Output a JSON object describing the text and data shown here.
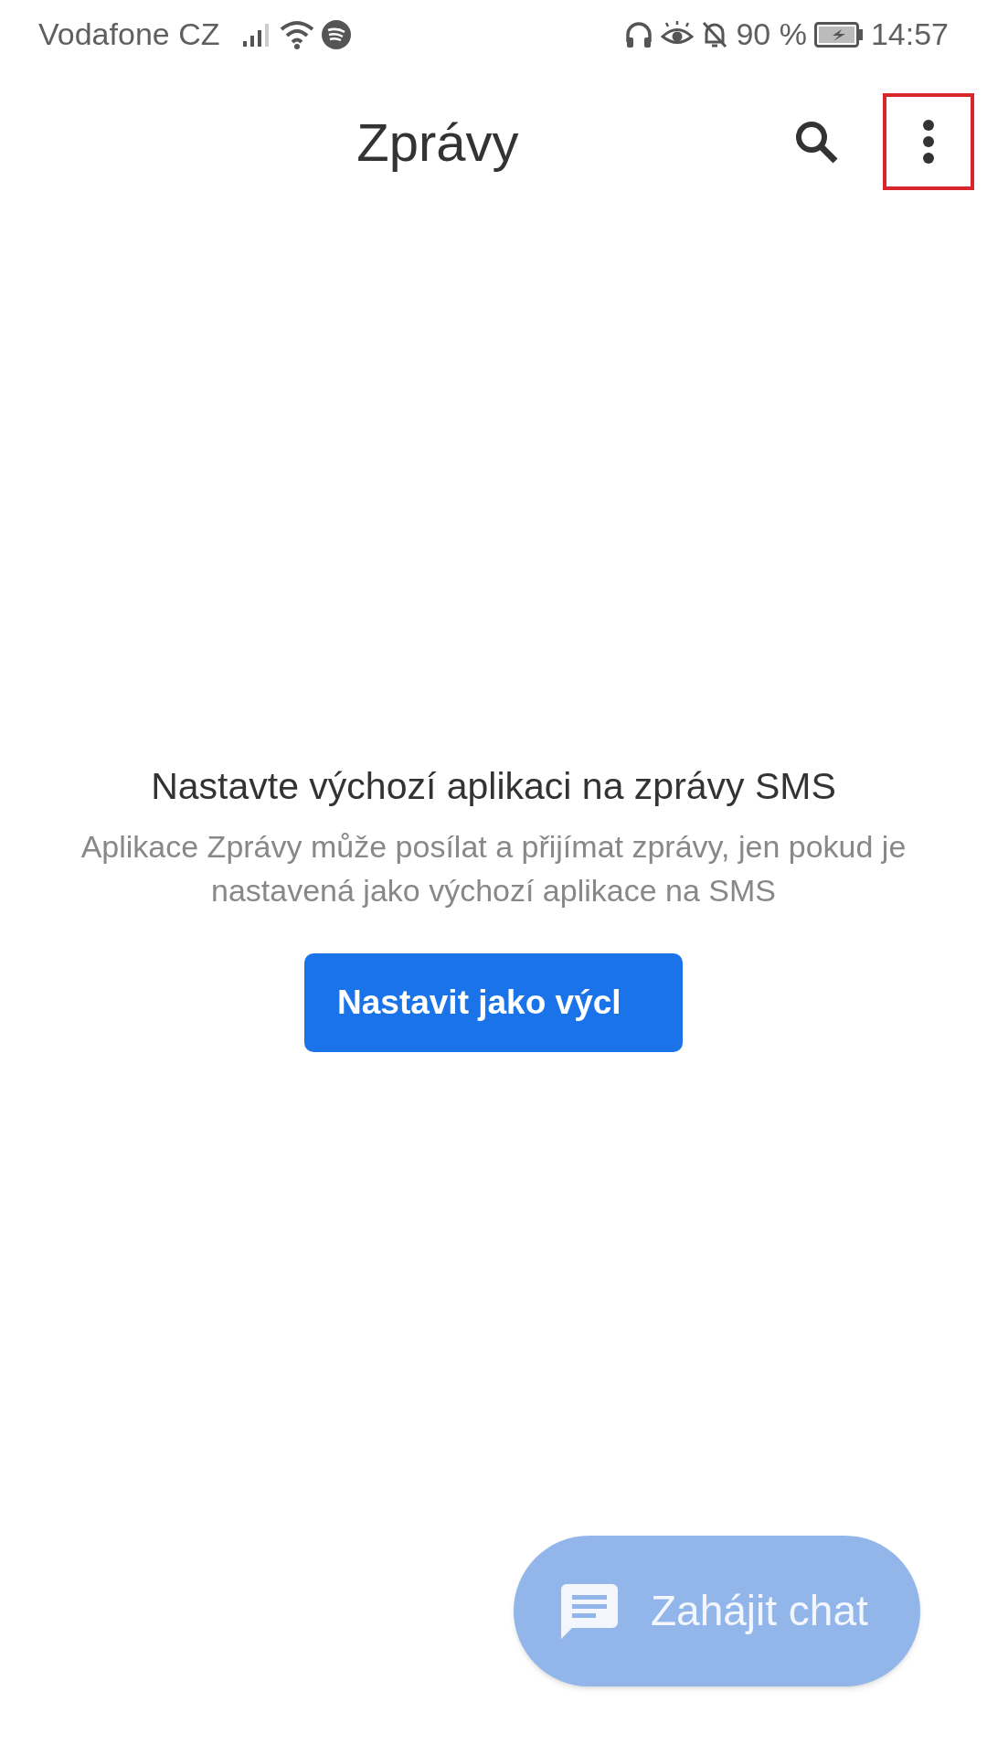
{
  "status_bar": {
    "carrier": "Vodafone CZ",
    "battery": "90 %",
    "time": "14:57"
  },
  "app_bar": {
    "title": "Zprávy",
    "menu_highlighted": true
  },
  "empty_state": {
    "heading": "Nastavte výchozí aplikaci na zprávy SMS",
    "body": "Aplikace Zprávy může posílat a přijímat zprávy, jen pokud je nastavená jako výchozí aplikace na SMS",
    "button": "Nastavit jako výcl"
  },
  "fab": {
    "label": "Zahájit chat",
    "disabled": true
  }
}
